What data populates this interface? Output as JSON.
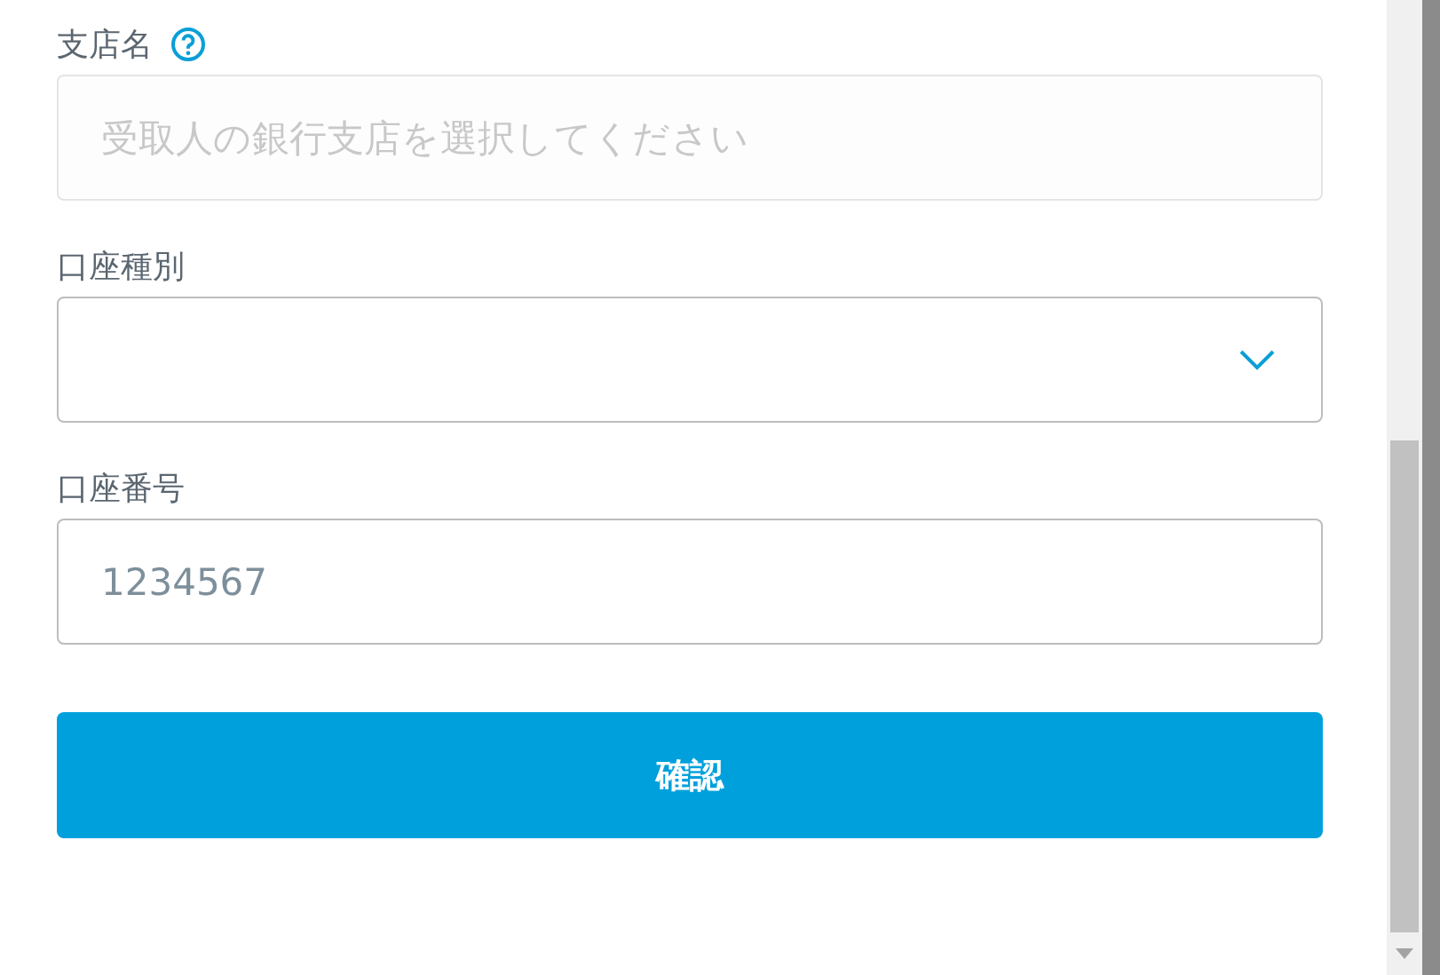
{
  "fields": [
    {
      "kind": "text",
      "label": "支店名",
      "help": true,
      "placeholder": "受取人の銀行支店を選択してください"
    },
    {
      "kind": "select",
      "label": "口座種別",
      "help": false
    },
    {
      "kind": "text",
      "label": "口座番号",
      "help": false,
      "value": "1234567"
    }
  ],
  "submit_button": {
    "label": "確認"
  }
}
